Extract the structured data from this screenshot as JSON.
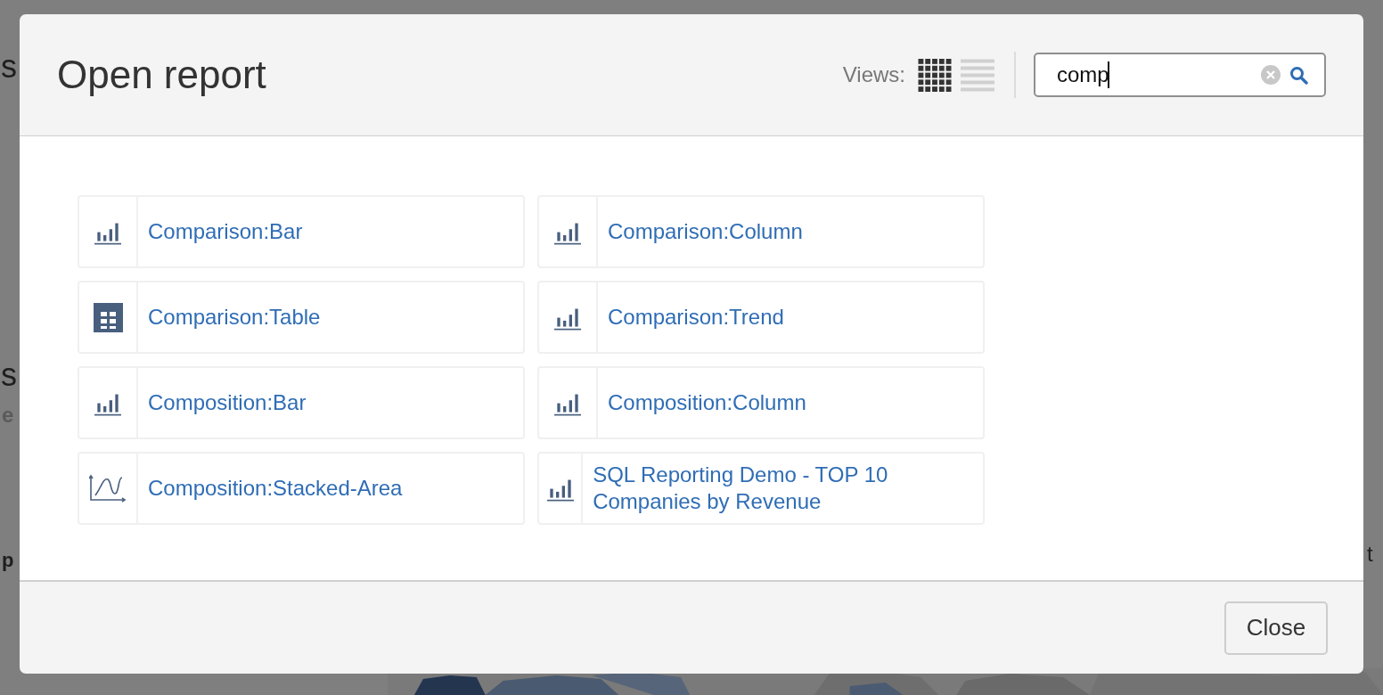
{
  "background": {
    "fragments": [
      "s",
      "s",
      "e",
      "p",
      "t"
    ]
  },
  "dialog": {
    "title": "Open report",
    "views_label": "Views:",
    "views": [
      {
        "kind": "grid",
        "selected": true
      },
      {
        "kind": "list",
        "selected": false
      }
    ],
    "search": {
      "value": "comp"
    },
    "reports": [
      {
        "label": "Comparison:Bar",
        "kind": "bar"
      },
      {
        "label": "Comparison:Column",
        "kind": "bar"
      },
      {
        "label": "Comparison:Table",
        "kind": "table"
      },
      {
        "label": "Comparison:Trend",
        "kind": "bar"
      },
      {
        "label": "Composition:Bar",
        "kind": "bar"
      },
      {
        "label": "Composition:Column",
        "kind": "bar"
      },
      {
        "label": "Composition:Stacked-Area",
        "kind": "area"
      },
      {
        "label": "SQL Reporting Demo - TOP 10 Companies by Revenue",
        "kind": "bar"
      }
    ],
    "close_button": "Close"
  }
}
